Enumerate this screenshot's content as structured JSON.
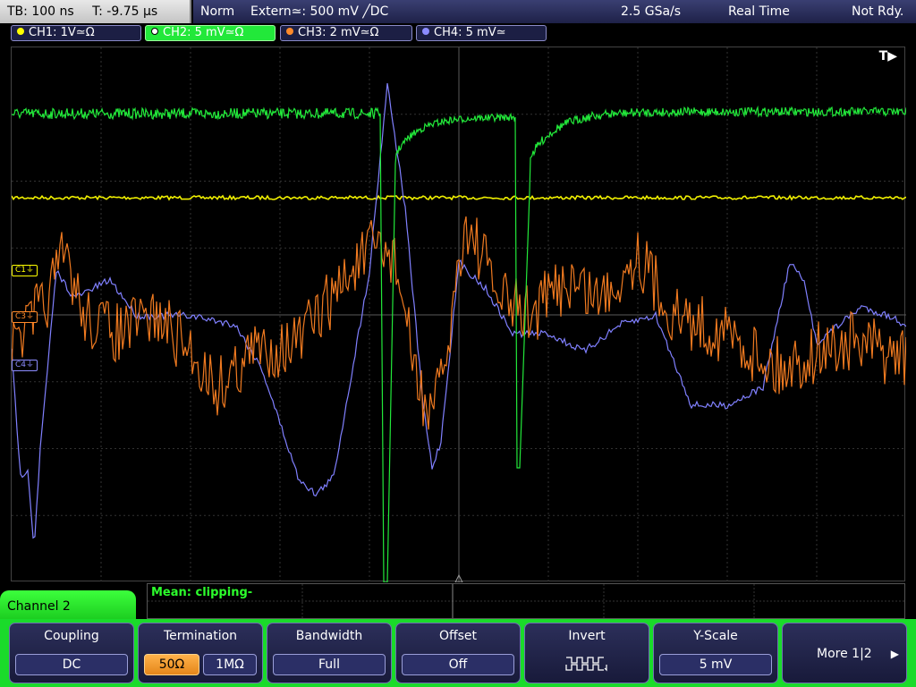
{
  "topbar": {
    "timebase": "TB: 100 ns",
    "trigger_pos": "T: -9.75 µs",
    "mode": "Norm",
    "trigger_source": "Extern≃: 500 mV ╱DC",
    "sample_rate": "2.5 GSa/s",
    "acq_mode": "Real Time",
    "status": "Not Rdy."
  },
  "channels": [
    {
      "label": "CH1: 1V≃Ω",
      "color": "#ffff00",
      "active": false
    },
    {
      "label": "CH2: 5 mV≃Ω",
      "color": "#22e83a",
      "active": true
    },
    {
      "label": "CH3: 2 mV≃Ω",
      "color": "#ff8a2a",
      "active": false
    },
    {
      "label": "CH4: 5 mV≃",
      "color": "#8c8cff",
      "active": false
    }
  ],
  "scope": {
    "trigger_marker": "T▶",
    "markers": [
      {
        "label": "C1⏚",
        "color": "#ffff00"
      },
      {
        "label": "C3⏚",
        "color": "#ff8a2a"
      },
      {
        "label": "C4⏚",
        "color": "#8c8cff"
      }
    ],
    "trace_colors": {
      "ch1": "#f0f000",
      "ch2": "#22e83a",
      "ch3": "#f07a20",
      "ch4": "#8080ff"
    }
  },
  "measurement": {
    "label": "Mean: clipping-"
  },
  "panel": {
    "title": "Channel 2",
    "coupling": {
      "title": "Coupling",
      "value": "DC"
    },
    "termination": {
      "title": "Termination",
      "opt1": "50Ω",
      "opt2": "1MΩ"
    },
    "bandwidth": {
      "title": "Bandwidth",
      "value": "Full"
    },
    "offset": {
      "title": "Offset",
      "value": "Off"
    },
    "invert": {
      "title": "Invert",
      "icon": "invert-waveform-icon"
    },
    "yscale": {
      "title": "Y-Scale",
      "value": "5 mV"
    },
    "more": {
      "label": "More 1|2",
      "arrow": "▶"
    }
  }
}
